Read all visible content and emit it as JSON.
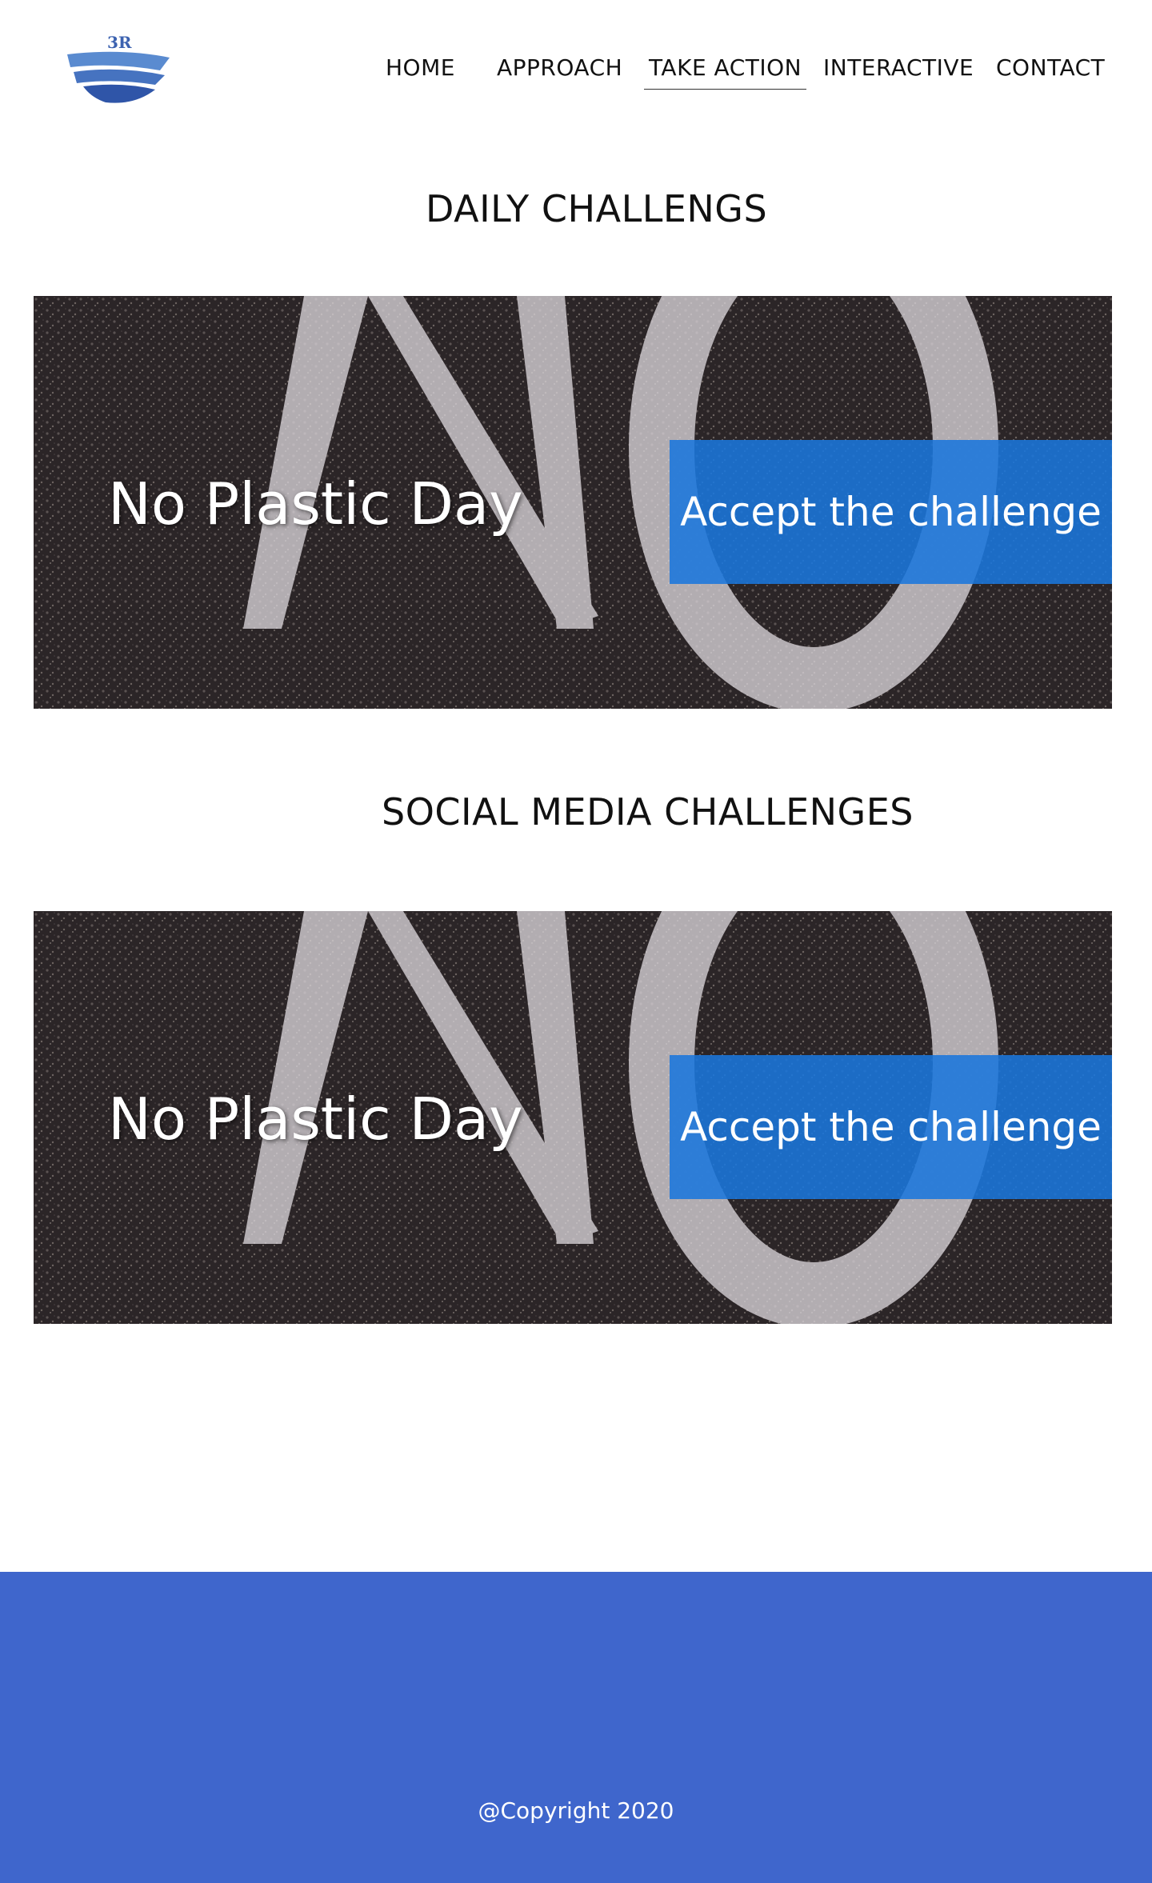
{
  "brand": {
    "logo_text": "3R"
  },
  "nav": {
    "items": [
      {
        "label": "HOME"
      },
      {
        "label": "APPROACH"
      },
      {
        "label": "TAKE ACTION",
        "active": true
      },
      {
        "label": "INTERACTIVE"
      },
      {
        "label": "CONTACT"
      }
    ]
  },
  "sections": [
    {
      "title": "DAILY CHALLENGS",
      "challenge": {
        "title": "No Plastic Day",
        "button_label": "Accept the challenge"
      }
    },
    {
      "title": "SOCIAL MEDIA CHALLENGES",
      "challenge": {
        "title": "No Plastic Day",
        "button_label": "Accept the challenge"
      }
    }
  ],
  "footer": {
    "copyright": "@Copyright 2020"
  },
  "colors": {
    "accent": "#1a76dc",
    "footer_bg": "#3f66cc",
    "logo_blue": "#3c62b0"
  }
}
